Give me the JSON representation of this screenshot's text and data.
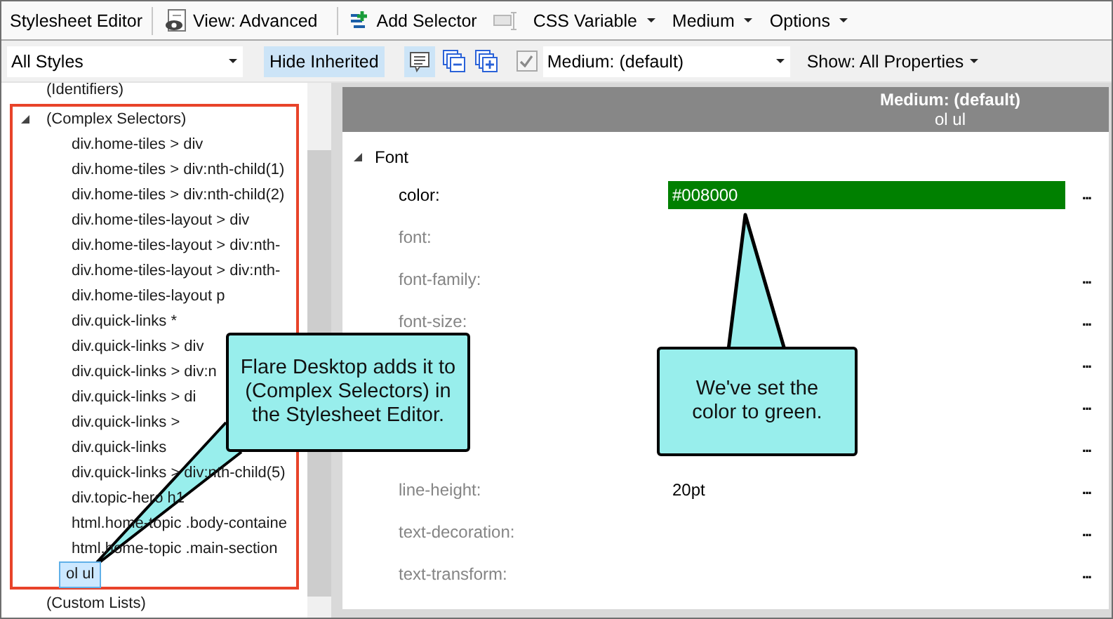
{
  "toolbar": {
    "items": [
      {
        "kind": "title",
        "label": "Stylesheet Editor"
      },
      {
        "kind": "separator"
      },
      {
        "kind": "view",
        "label": "View: Advanced"
      },
      {
        "kind": "separator"
      },
      {
        "kind": "add",
        "label": "Add Selector"
      },
      {
        "kind": "tool",
        "disabled": true
      },
      {
        "kind": "menu",
        "label": "CSS Variable"
      },
      {
        "kind": "menu",
        "label": "Medium"
      },
      {
        "kind": "menu",
        "label": "Options"
      }
    ]
  },
  "filter_bar": {
    "items": [
      {
        "kind": "combo",
        "value": "All Styles"
      },
      {
        "kind": "toggle",
        "label": "Hide Inherited",
        "selected": true
      },
      {
        "kind": "notes-toggle",
        "selected": true
      },
      {
        "kind": "collapse"
      },
      {
        "kind": "expand"
      },
      {
        "kind": "check",
        "checked": true,
        "disabled": true
      },
      {
        "kind": "combo",
        "value": "Medium: (default)"
      },
      {
        "kind": "menu",
        "label": "Show: All Properties"
      }
    ]
  },
  "tree": {
    "items": [
      {
        "label": "(Identifiers)"
      },
      {
        "label": "(Complex Selectors)",
        "expanded": true,
        "framed": true,
        "children": [
          {
            "label": "div.home-tiles > div",
            "selected": false
          },
          {
            "label": "div.home-tiles > div:nth-child(1)",
            "selected": false
          },
          {
            "label": "div.home-tiles > div:nth-child(2)",
            "selected": false
          },
          {
            "label": "div.home-tiles-layout > div",
            "selected": false
          },
          {
            "label": "div.home-tiles-layout > div:nth-",
            "selected": false
          },
          {
            "label": "div.home-tiles-layout > div:nth-",
            "selected": false
          },
          {
            "label": "div.home-tiles-layout p",
            "selected": false
          },
          {
            "label": "div.quick-links *",
            "selected": false
          },
          {
            "label": "div.quick-links > div",
            "selected": false
          },
          {
            "label": "div.quick-links > div:n",
            "selected": false
          },
          {
            "label": "div.quick-links > di",
            "selected": false
          },
          {
            "label": "div.quick-links >",
            "selected": false
          },
          {
            "label": "div.quick-links",
            "selected": false
          },
          {
            "label": "div.quick-links > div:nth-child(5)",
            "selected": false
          },
          {
            "label": "div.topic-hero h1",
            "selected": false
          },
          {
            "label": "html.home-topic .body-containe",
            "selected": false
          },
          {
            "label": "html.home-topic .main-section",
            "selected": false
          },
          {
            "label": "ol ul",
            "selected": true
          }
        ]
      },
      {
        "label": "(Custom Lists)"
      }
    ]
  },
  "properties": {
    "header": {
      "title": "Medium: (default)",
      "subtitle": "ol ul"
    },
    "section": {
      "label": "Font",
      "expanded": true
    },
    "rows": [
      {
        "label": "color:",
        "kind": "color",
        "value": "#008000",
        "color": "#008000",
        "set": true,
        "menu": "..."
      },
      {
        "label": "font:",
        "kind": "none",
        "set": false
      },
      {
        "label": "font-family:",
        "kind": "none",
        "set": false,
        "menu": "..."
      },
      {
        "label": "font-size:",
        "kind": "none",
        "set": false,
        "menu": "..."
      },
      {
        "kind": "none",
        "menu": "..."
      },
      {
        "kind": "none",
        "menu": "..."
      },
      {
        "kind": "none",
        "menu": "..."
      },
      {
        "label": "line-height:",
        "kind": "text",
        "value": "20pt",
        "set": false,
        "menu": "..."
      },
      {
        "label": "text-decoration:",
        "kind": "none",
        "set": false,
        "menu": "..."
      },
      {
        "label": "text-transform:",
        "kind": "none",
        "set": false,
        "menu": "..."
      }
    ]
  },
  "callouts": [
    {
      "text": "Flare Desktop adds it to\n(Complex Selectors) in\nthe Stylesheet Editor."
    },
    {
      "text": "We've set the\ncolor to green."
    }
  ]
}
